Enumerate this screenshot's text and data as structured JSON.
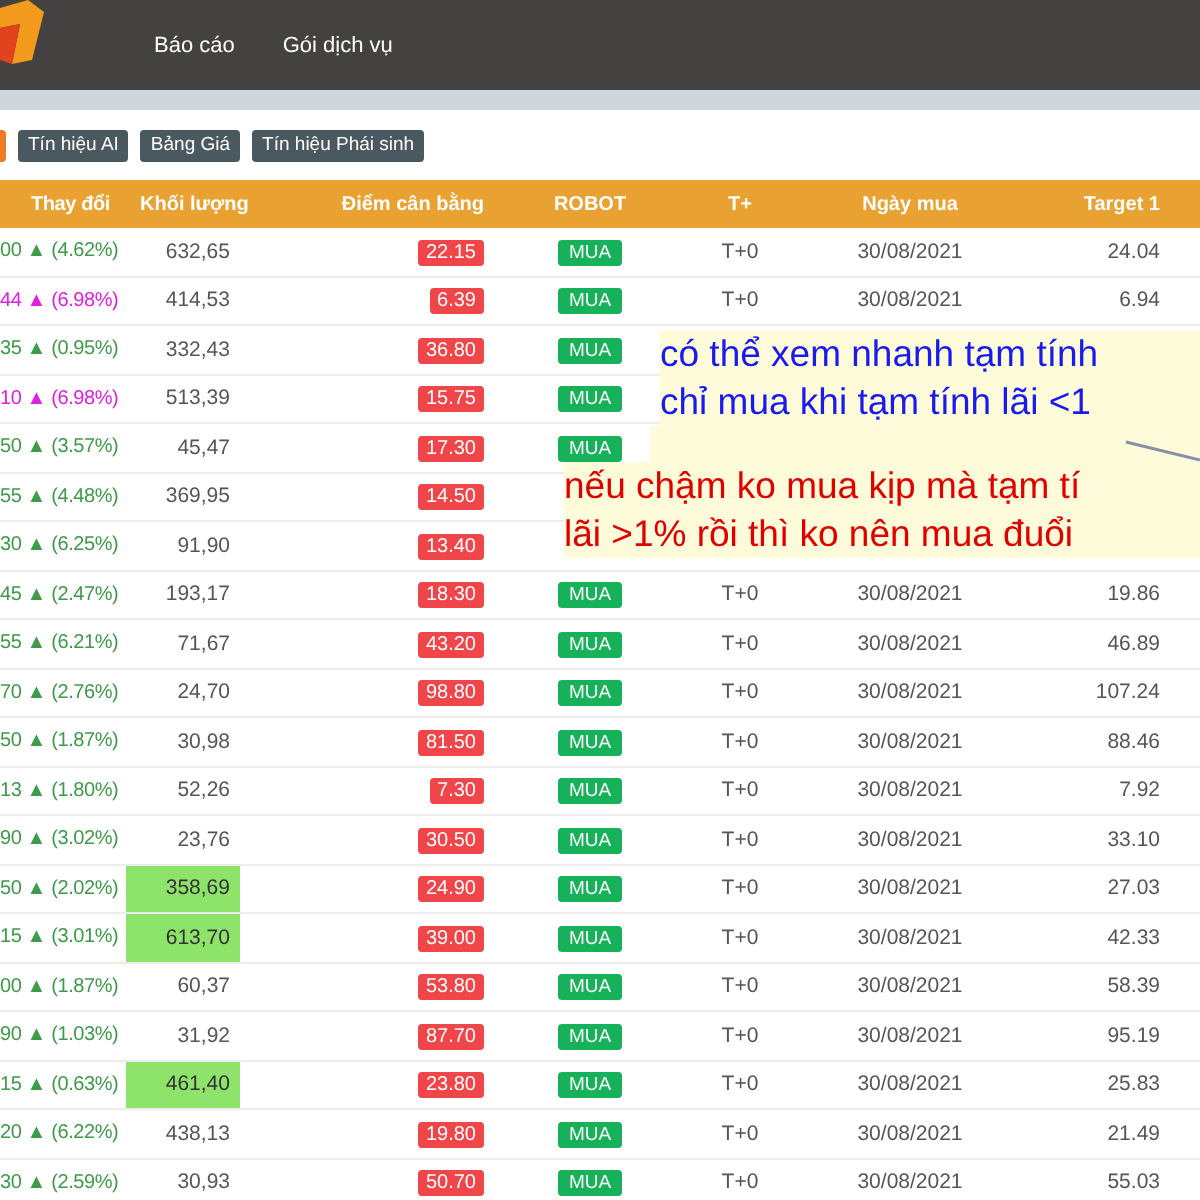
{
  "nav": {
    "items": [
      "Báo cáo",
      "Gói dịch vụ"
    ]
  },
  "tabs": [
    {
      "selected": true
    },
    {
      "label": "Tín hiệu AI",
      "selected": false
    },
    {
      "label": "Bảng Giá",
      "selected": false
    },
    {
      "label": "Tín hiệu Phái sinh",
      "selected": false
    }
  ],
  "table": {
    "columns": [
      "Thay đổi",
      "Khối lượng",
      "Điểm cân bằng",
      "ROBOT",
      "T+",
      "Ngày mua",
      "Target 1"
    ],
    "rows": [
      {
        "change": "00 ▲ (4.62%)",
        "kind": "up",
        "volume": "632,65",
        "volume_highlight": false,
        "balance": "22.15",
        "robot": "MUA",
        "t_plus": "T+0",
        "buy_date": "30/08/2021",
        "target1": "24.04"
      },
      {
        "change": "44 ▲ (6.98%)",
        "kind": "ceiling",
        "volume": "414,53",
        "volume_highlight": false,
        "balance": "6.39",
        "robot": "MUA",
        "t_plus": "T+0",
        "buy_date": "30/08/2021",
        "target1": "6.94"
      },
      {
        "change": "35 ▲ (0.95%)",
        "kind": "up",
        "volume": "332,43",
        "volume_highlight": false,
        "balance": "36.80",
        "robot": "MUA"
      },
      {
        "change": "10 ▲ (6.98%)",
        "kind": "ceiling",
        "volume": "513,39",
        "volume_highlight": false,
        "balance": "15.75",
        "robot": "MUA"
      },
      {
        "change": "50 ▲ (3.57%)",
        "kind": "up",
        "volume": "45,47",
        "volume_highlight": false,
        "balance": "17.30",
        "robot": "MUA"
      },
      {
        "change": "55 ▲ (4.48%)",
        "kind": "up",
        "volume": "369,95",
        "volume_highlight": false,
        "balance": "14.50"
      },
      {
        "change": "30 ▲ (6.25%)",
        "kind": "up",
        "volume": "91,90",
        "volume_highlight": false,
        "balance": "13.40"
      },
      {
        "change": "45 ▲ (2.47%)",
        "kind": "up",
        "volume": "193,17",
        "volume_highlight": false,
        "balance": "18.30",
        "robot": "MUA",
        "t_plus": "T+0",
        "buy_date": "30/08/2021",
        "target1": "19.86"
      },
      {
        "change": "55 ▲ (6.21%)",
        "kind": "up",
        "volume": "71,67",
        "volume_highlight": false,
        "balance": "43.20",
        "robot": "MUA",
        "t_plus": "T+0",
        "buy_date": "30/08/2021",
        "target1": "46.89"
      },
      {
        "change": "70 ▲ (2.76%)",
        "kind": "up",
        "volume": "24,70",
        "volume_highlight": false,
        "balance": "98.80",
        "robot": "MUA",
        "t_plus": "T+0",
        "buy_date": "30/08/2021",
        "target1": "107.24"
      },
      {
        "change": "50 ▲ (1.87%)",
        "kind": "up",
        "volume": "30,98",
        "volume_highlight": false,
        "balance": "81.50",
        "robot": "MUA",
        "t_plus": "T+0",
        "buy_date": "30/08/2021",
        "target1": "88.46"
      },
      {
        "change": "13 ▲ (1.80%)",
        "kind": "up",
        "volume": "52,26",
        "volume_highlight": false,
        "balance": "7.30",
        "robot": "MUA",
        "t_plus": "T+0",
        "buy_date": "30/08/2021",
        "target1": "7.92"
      },
      {
        "change": "90 ▲ (3.02%)",
        "kind": "up",
        "volume": "23,76",
        "volume_highlight": false,
        "balance": "30.50",
        "robot": "MUA",
        "t_plus": "T+0",
        "buy_date": "30/08/2021",
        "target1": "33.10"
      },
      {
        "change": "50 ▲ (2.02%)",
        "kind": "up",
        "volume": "358,69",
        "volume_highlight": true,
        "balance": "24.90",
        "robot": "MUA",
        "t_plus": "T+0",
        "buy_date": "30/08/2021",
        "target1": "27.03"
      },
      {
        "change": "15 ▲ (3.01%)",
        "kind": "up",
        "volume": "613,70",
        "volume_highlight": true,
        "balance": "39.00",
        "robot": "MUA",
        "t_plus": "T+0",
        "buy_date": "30/08/2021",
        "target1": "42.33"
      },
      {
        "change": "00 ▲ (1.87%)",
        "kind": "up",
        "volume": "60,37",
        "volume_highlight": false,
        "balance": "53.80",
        "robot": "MUA",
        "t_plus": "T+0",
        "buy_date": "30/08/2021",
        "target1": "58.39"
      },
      {
        "change": "90 ▲ (1.03%)",
        "kind": "up",
        "volume": "31,92",
        "volume_highlight": false,
        "balance": "87.70",
        "robot": "MUA",
        "t_plus": "T+0",
        "buy_date": "30/08/2021",
        "target1": "95.19"
      },
      {
        "change": "15 ▲ (0.63%)",
        "kind": "up",
        "volume": "461,40",
        "volume_highlight": true,
        "balance": "23.80",
        "robot": "MUA",
        "t_plus": "T+0",
        "buy_date": "30/08/2021",
        "target1": "25.83"
      },
      {
        "change": "20 ▲ (6.22%)",
        "kind": "up",
        "volume": "438,13",
        "volume_highlight": false,
        "balance": "19.80",
        "robot": "MUA",
        "t_plus": "T+0",
        "buy_date": "30/08/2021",
        "target1": "21.49"
      },
      {
        "change": "30 ▲ (2.59%)",
        "kind": "up",
        "volume": "30,93",
        "volume_highlight": false,
        "balance": "50.70",
        "robot": "MUA",
        "t_plus": "T+0",
        "buy_date": "30/08/2021",
        "target1": "55.03"
      }
    ]
  },
  "note": {
    "lines": [
      {
        "text": "có thể xem nhanh tạm tính",
        "kind": "tip"
      },
      {
        "text": "chỉ mua khi tạm tính lãi <1",
        "kind": "tip"
      },
      {
        "text": "nếu chậm ko mua kịp mà tạm tí",
        "kind": "warning"
      },
      {
        "text": "lãi >1% rồi thì ko nên mua đuổi",
        "kind": "warning"
      }
    ]
  }
}
